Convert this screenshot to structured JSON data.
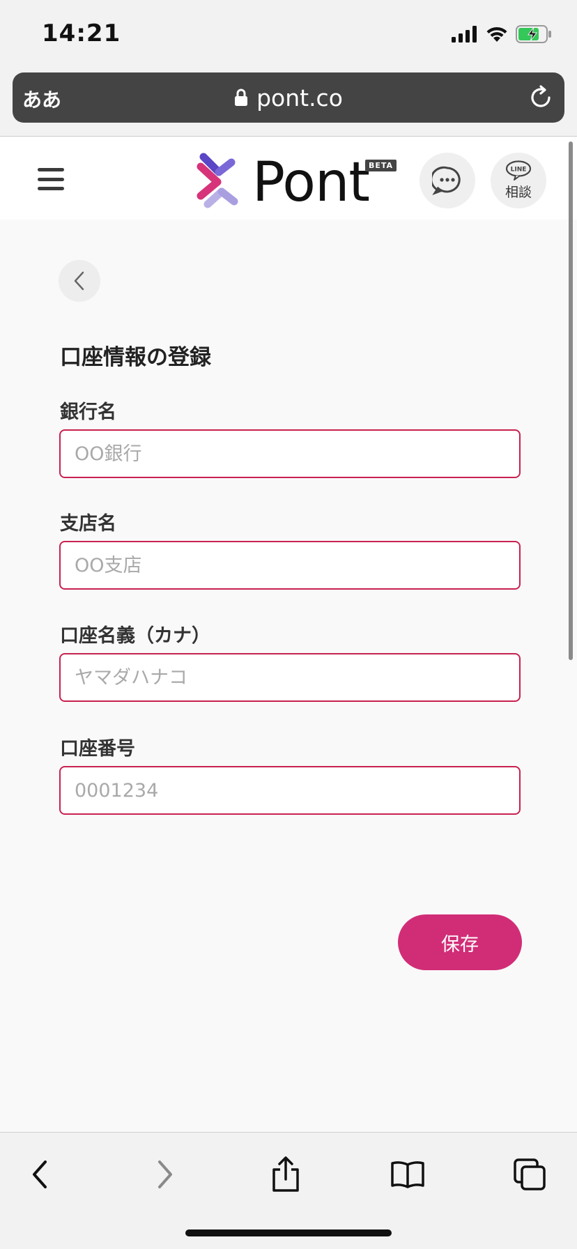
{
  "status_bar": {
    "time": "14:21"
  },
  "browser": {
    "text_size_label": "ああ",
    "url": "pont.co"
  },
  "header": {
    "logo_text": "Pont",
    "beta_label": "BETA",
    "line_small": "LINE",
    "line_label": "相談"
  },
  "form": {
    "title": "口座情報の登録",
    "fields": [
      {
        "label": "銀行名",
        "placeholder": "OO銀行",
        "value": ""
      },
      {
        "label": "支店名",
        "placeholder": "OO支店",
        "value": ""
      },
      {
        "label": "口座名義（カナ）",
        "placeholder": "ヤマダハナコ",
        "value": ""
      },
      {
        "label": "口座番号",
        "placeholder": "0001234",
        "value": ""
      }
    ],
    "save_label": "保存"
  },
  "colors": {
    "accent": "#d12d77",
    "input_border": "#c8214f",
    "logo_pink": "#d6337a",
    "logo_purple": "#5b46c6"
  },
  "icons": [
    "signal-icon",
    "wifi-icon",
    "battery-icon",
    "lock-icon",
    "reload-icon",
    "menu-icon",
    "chat-icon",
    "line-icon",
    "chevron-left-icon",
    "back-icon",
    "forward-icon",
    "share-icon",
    "bookmarks-icon",
    "tabs-icon"
  ]
}
